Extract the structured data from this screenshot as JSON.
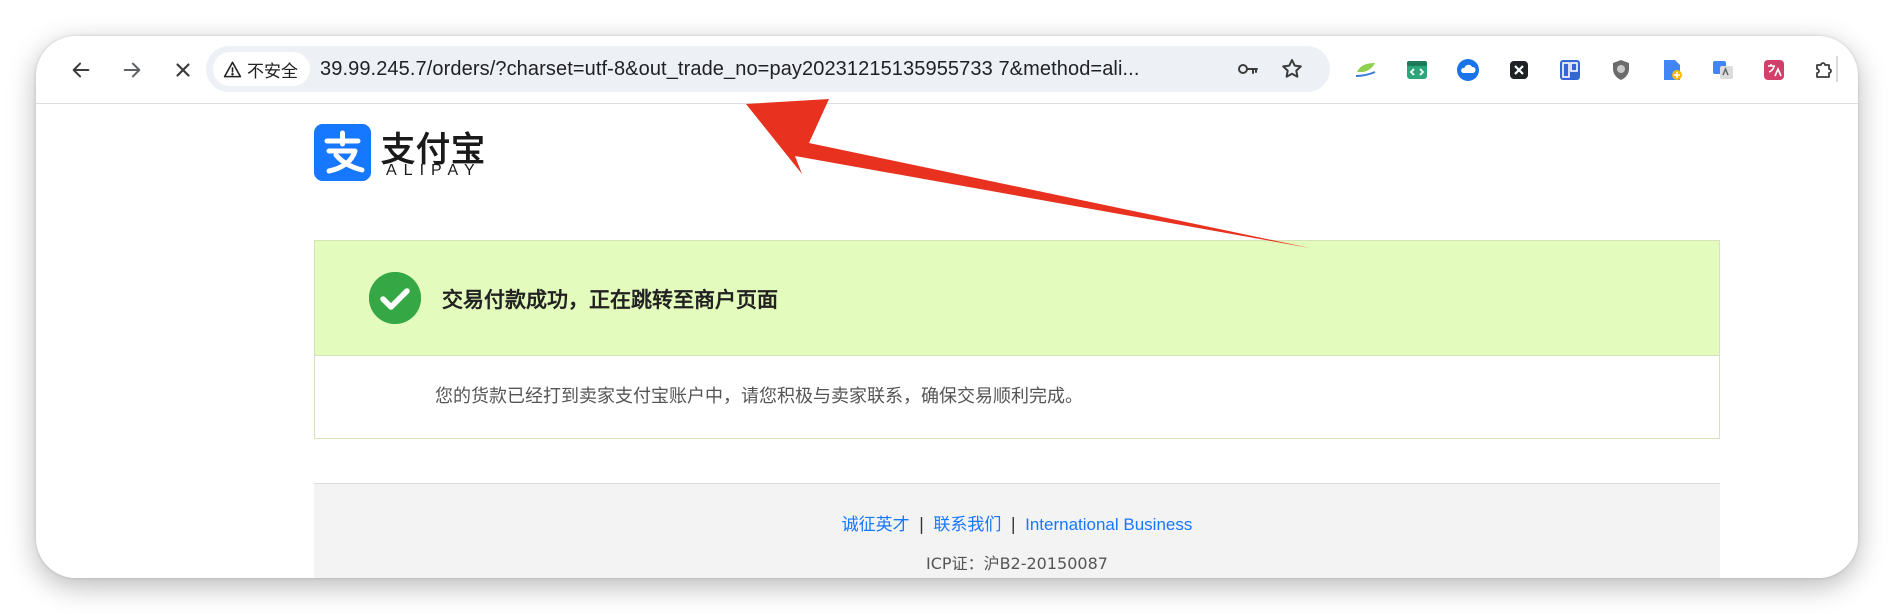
{
  "browser": {
    "security_label": "不安全",
    "url": "39.99.245.7/orders/?charset=utf-8&out_trade_no=pay20231215135955733 7&method=ali..."
  },
  "page": {
    "logo": {
      "cn": "支付宝",
      "en": "ALIPAY"
    },
    "success": {
      "title": "交易付款成功，正在跳转至商户页面",
      "description": "您的货款已经打到卖家支付宝账户中，请您积极与卖家联系，确保交易顺利完成。"
    },
    "footer": {
      "links": [
        "诚征英才",
        "联系我们",
        "International Business"
      ],
      "separator": "|",
      "icp": "ICP证：沪B2-20150087"
    }
  },
  "colors": {
    "alipay_blue": "#1677ff",
    "success_green": "#35a845",
    "success_bg": "#e3fbbc",
    "annotation_red": "#e8321f"
  },
  "icons": {
    "toolbar": [
      "back-icon",
      "forward-icon",
      "stop-icon",
      "warning-icon",
      "key-icon",
      "star-icon"
    ],
    "extensions": [
      "ext-translate-icon",
      "ext-code-icon",
      "ext-cloud-icon",
      "ext-x-icon",
      "ext-grid-icon",
      "ext-shield-icon",
      "ext-file-icon",
      "ext-google-translate-icon",
      "ext-language-icon",
      "puzzle-icon"
    ]
  }
}
